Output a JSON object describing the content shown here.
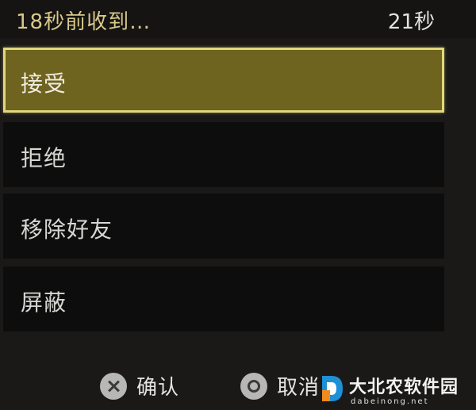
{
  "header": {
    "message": "18秒前收到…",
    "timer": "21秒"
  },
  "menu": {
    "selected_index": 0,
    "items": [
      {
        "label": "接受"
      },
      {
        "label": "拒绝"
      },
      {
        "label": "移除好友"
      },
      {
        "label": "屏蔽"
      }
    ]
  },
  "footer": {
    "confirm": {
      "icon": "cross-button-icon",
      "label": "确认"
    },
    "cancel": {
      "icon": "circle-button-icon",
      "label": "取消"
    }
  },
  "watermark": {
    "name": "大北农软件园",
    "domain": "dabeinong.net"
  },
  "colors": {
    "highlight_fill": "#6f6320",
    "highlight_border": "#e2d77c",
    "header_text": "#d8c98a"
  }
}
